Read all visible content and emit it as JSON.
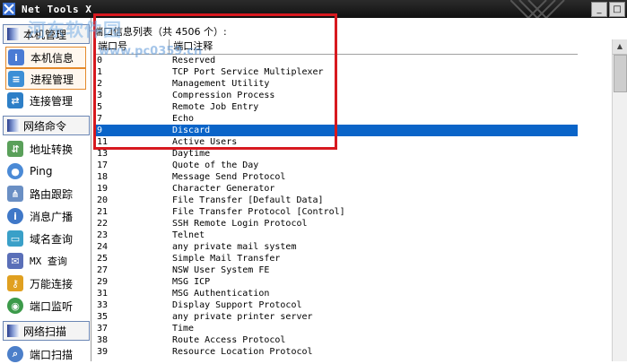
{
  "window": {
    "title": "Net Tools X",
    "controls": [
      "_",
      "□"
    ]
  },
  "sidebar": {
    "groups": [
      {
        "label": "本机管理",
        "items": [
          {
            "label": "本机信息",
            "icon": "computer-info-icon",
            "active": true
          },
          {
            "label": "进程管理",
            "icon": "process-icon",
            "active": true
          },
          {
            "label": "连接管理",
            "icon": "connection-icon",
            "active": false
          }
        ]
      },
      {
        "label": "网络命令",
        "items": [
          {
            "label": "地址转换",
            "icon": "address-convert-icon"
          },
          {
            "label": "Ping",
            "icon": "ping-icon"
          },
          {
            "label": "路由跟踪",
            "icon": "route-trace-icon"
          },
          {
            "label": "消息广播",
            "icon": "broadcast-icon"
          },
          {
            "label": "域名查询",
            "icon": "domain-query-icon"
          },
          {
            "label": "MX 查询",
            "icon": "mx-query-icon"
          },
          {
            "label": "万能连接",
            "icon": "universal-connect-icon"
          },
          {
            "label": "端口监听",
            "icon": "port-listen-icon"
          }
        ]
      },
      {
        "label": "网络扫描",
        "items": [
          {
            "label": "端口扫描",
            "icon": "port-scan-icon"
          }
        ]
      }
    ]
  },
  "main": {
    "caption": "端口信息列表（共 4506 个）:",
    "columns": [
      "端口号",
      "端口注释"
    ],
    "rows": [
      {
        "port": "0",
        "note": "Reserved"
      },
      {
        "port": "1",
        "note": "TCP Port Service Multiplexer"
      },
      {
        "port": "2",
        "note": "Management Utility"
      },
      {
        "port": "3",
        "note": "Compression Process"
      },
      {
        "port": "5",
        "note": "Remote Job Entry"
      },
      {
        "port": "7",
        "note": "Echo"
      },
      {
        "port": "9",
        "note": "Discard",
        "selected": true
      },
      {
        "port": "11",
        "note": "Active Users"
      },
      {
        "port": "13",
        "note": "Daytime"
      },
      {
        "port": "17",
        "note": "Quote of the Day"
      },
      {
        "port": "18",
        "note": "Message Send Protocol"
      },
      {
        "port": "19",
        "note": "Character Generator"
      },
      {
        "port": "20",
        "note": "File Transfer [Default Data]"
      },
      {
        "port": "21",
        "note": "File Transfer Protocol [Control]"
      },
      {
        "port": "22",
        "note": "SSH Remote Login Protocol"
      },
      {
        "port": "23",
        "note": "Telnet"
      },
      {
        "port": "24",
        "note": "any private mail system"
      },
      {
        "port": "25",
        "note": "Simple Mail Transfer"
      },
      {
        "port": "27",
        "note": "NSW User System FE"
      },
      {
        "port": "29",
        "note": "MSG ICP"
      },
      {
        "port": "31",
        "note": "MSG Authentication"
      },
      {
        "port": "33",
        "note": "Display Support Protocol"
      },
      {
        "port": "35",
        "note": "any private printer server"
      },
      {
        "port": "37",
        "note": "Time"
      },
      {
        "port": "38",
        "note": "Route Access Protocol"
      },
      {
        "port": "39",
        "note": "Resource Location Protocol"
      }
    ]
  },
  "watermark": {
    "text": "河东软件园",
    "url": "www.pc0359.cn"
  },
  "colors": {
    "selection": "#0a64c8",
    "highlight_box": "#d7191f",
    "title_bar": "#1a1a1a"
  }
}
